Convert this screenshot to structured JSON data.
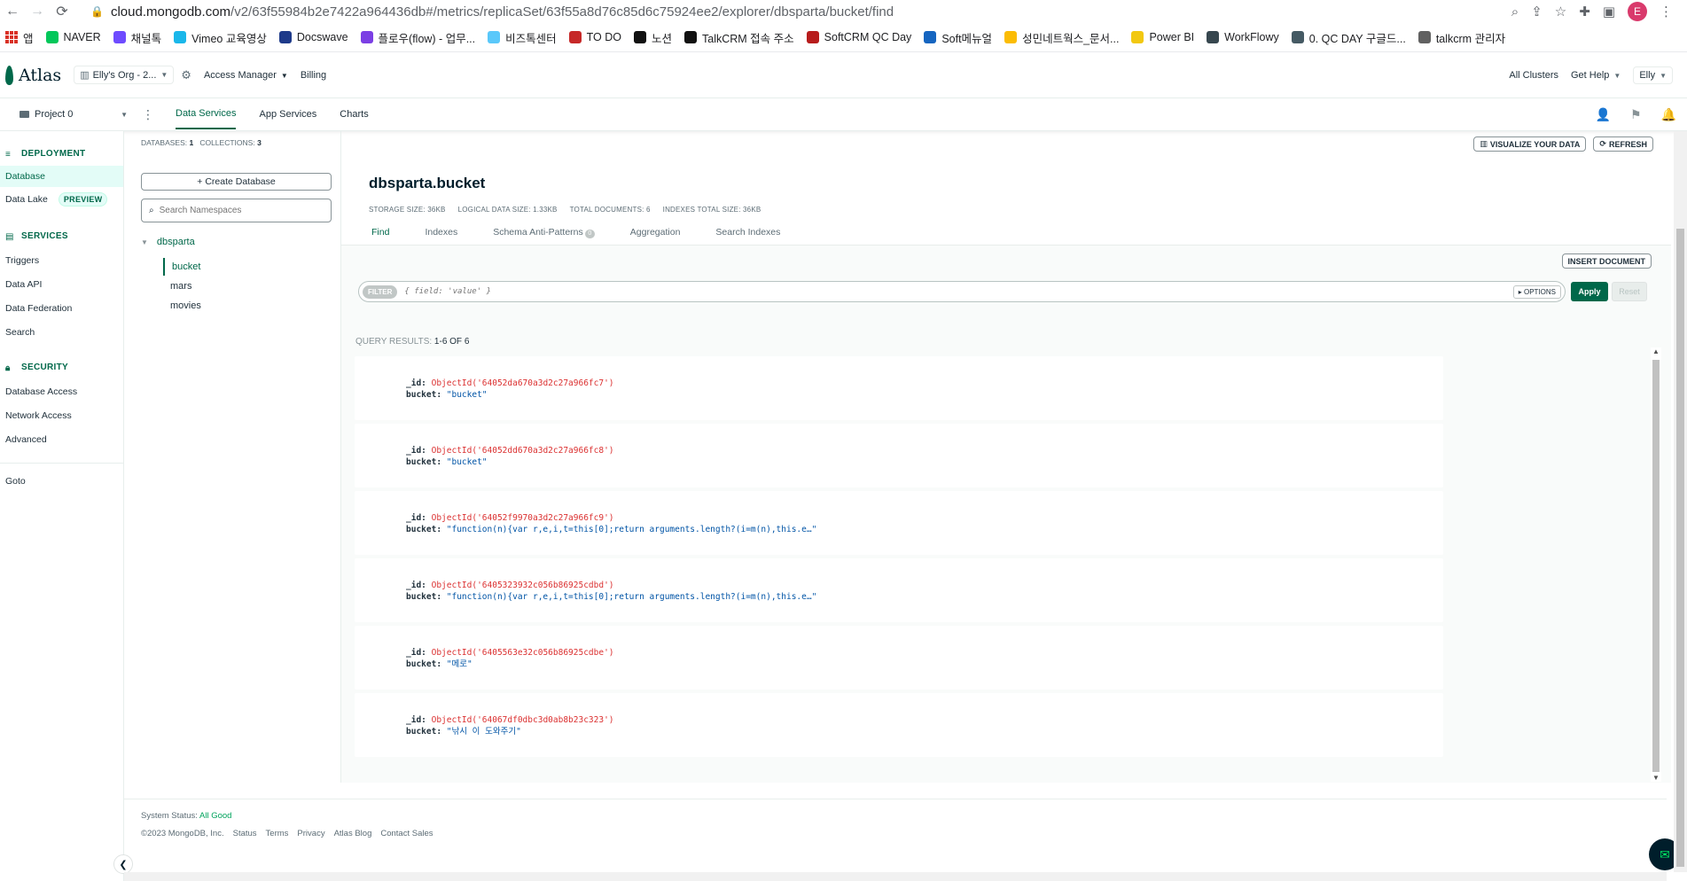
{
  "browser": {
    "url_host": "cloud.mongodb.com",
    "url_path": "/v2/63f55984b2e7422a964436db#/metrics/replicaSet/63f55a8d76c85d6c75924ee2/explorer/dbsparta/bucket/find",
    "profile_initial": "E"
  },
  "bookmarks": [
    {
      "label": "앱",
      "color": "#d93025"
    },
    {
      "label": "NAVER",
      "color": "#03c75a"
    },
    {
      "label": "채널톡",
      "color": "#6e4bff"
    },
    {
      "label": "Vimeo 교육영상",
      "color": "#1ab7ea"
    },
    {
      "label": "Docswave",
      "color": "#1e3a8a"
    },
    {
      "label": "플로우(flow) - 업무...",
      "color": "#7b3fe4"
    },
    {
      "label": "비즈톡센터",
      "color": "#5ac8fa"
    },
    {
      "label": "TO DO",
      "color": "#c62828"
    },
    {
      "label": "노션",
      "color": "#111111"
    },
    {
      "label": "TalkCRM 접속 주소",
      "color": "#111111"
    },
    {
      "label": "SoftCRM QC Day",
      "color": "#b71c1c"
    },
    {
      "label": "Soft메뉴얼",
      "color": "#1565c0"
    },
    {
      "label": "성민네트웍스_문서...",
      "color": "#fbbc04"
    },
    {
      "label": "Power BI",
      "color": "#f2c811"
    },
    {
      "label": "WorkFlowy",
      "color": "#37474f"
    },
    {
      "label": "0. QC DAY 구글드...",
      "color": "#455a64"
    },
    {
      "label": "talkcrm 관리자",
      "color": "#616161"
    }
  ],
  "atlas_nav": {
    "logo": "Atlas",
    "org": "Elly's Org - 2...",
    "access_manager": "Access Manager",
    "billing": "Billing",
    "all_clusters": "All Clusters",
    "get_help": "Get Help",
    "user": "Elly"
  },
  "project_bar": {
    "project": "Project 0",
    "tabs": [
      "Data Services",
      "App Services",
      "Charts"
    ]
  },
  "sidebar": {
    "deployment": "DEPLOYMENT",
    "database": "Database",
    "data_lake": "Data Lake",
    "preview": "PREVIEW",
    "services": "SERVICES",
    "triggers": "Triggers",
    "data_api": "Data API",
    "data_federation": "Data Federation",
    "search": "Search",
    "security": "SECURITY",
    "database_access": "Database Access",
    "network_access": "Network Access",
    "advanced": "Advanced",
    "goto": "Goto"
  },
  "namespaces": {
    "databases_label": "DATABASES:",
    "databases_count": "1",
    "collections_label": "COLLECTIONS:",
    "collections_count": "3",
    "create_db": "+ Create Database",
    "search_placeholder": "Search Namespaces",
    "db": "dbsparta",
    "collections": [
      "bucket",
      "mars",
      "movies"
    ]
  },
  "main": {
    "visualize": "VISUALIZE YOUR DATA",
    "refresh": "REFRESH",
    "title": "dbsparta.bucket",
    "stats": [
      "STORAGE SIZE: 36KB",
      "LOGICAL DATA SIZE: 1.33KB",
      "TOTAL DOCUMENTS: 6",
      "INDEXES TOTAL SIZE: 36KB"
    ],
    "tabs": [
      "Find",
      "Indexes",
      "Schema Anti-Patterns",
      "Aggregation",
      "Search Indexes"
    ],
    "schema_count": "0",
    "insert_document": "INSERT DOCUMENT",
    "filter_label": "FILTER",
    "filter_placeholder": "{ field: 'value' }",
    "options": "▸ OPTIONS",
    "apply": "Apply",
    "reset": "Reset",
    "query_results_label": "QUERY RESULTS:",
    "query_results_range": "1-6 OF 6"
  },
  "documents": [
    {
      "id": "ObjectId('64052da670a3d2c27a966fc7')",
      "bucket": "\"bucket\""
    },
    {
      "id": "ObjectId('64052dd670a3d2c27a966fc8')",
      "bucket": "\"bucket\""
    },
    {
      "id": "ObjectId('64052f9970a3d2c27a966fc9')",
      "bucket": "\"function(n){var r,e,i,t=this[0];return arguments.length?(i=m(n),this.e…\""
    },
    {
      "id": "ObjectId('6405323932c056b86925cdbd')",
      "bucket": "\"function(n){var r,e,i,t=this[0];return arguments.length?(i=m(n),this.e…\""
    },
    {
      "id": "ObjectId('6405563e32c056b86925cdbe')",
      "bucket": "\"메로\""
    },
    {
      "id": "ObjectId('64067df0dbc3d0ab8b23c323')",
      "bucket": "\"낚시 이 도와주기\""
    }
  ],
  "footer": {
    "status_label": "System Status:",
    "status_value": "All Good",
    "links": [
      "©2023 MongoDB, Inc.",
      "Status",
      "Terms",
      "Privacy",
      "Atlas Blog",
      "Contact Sales"
    ]
  }
}
